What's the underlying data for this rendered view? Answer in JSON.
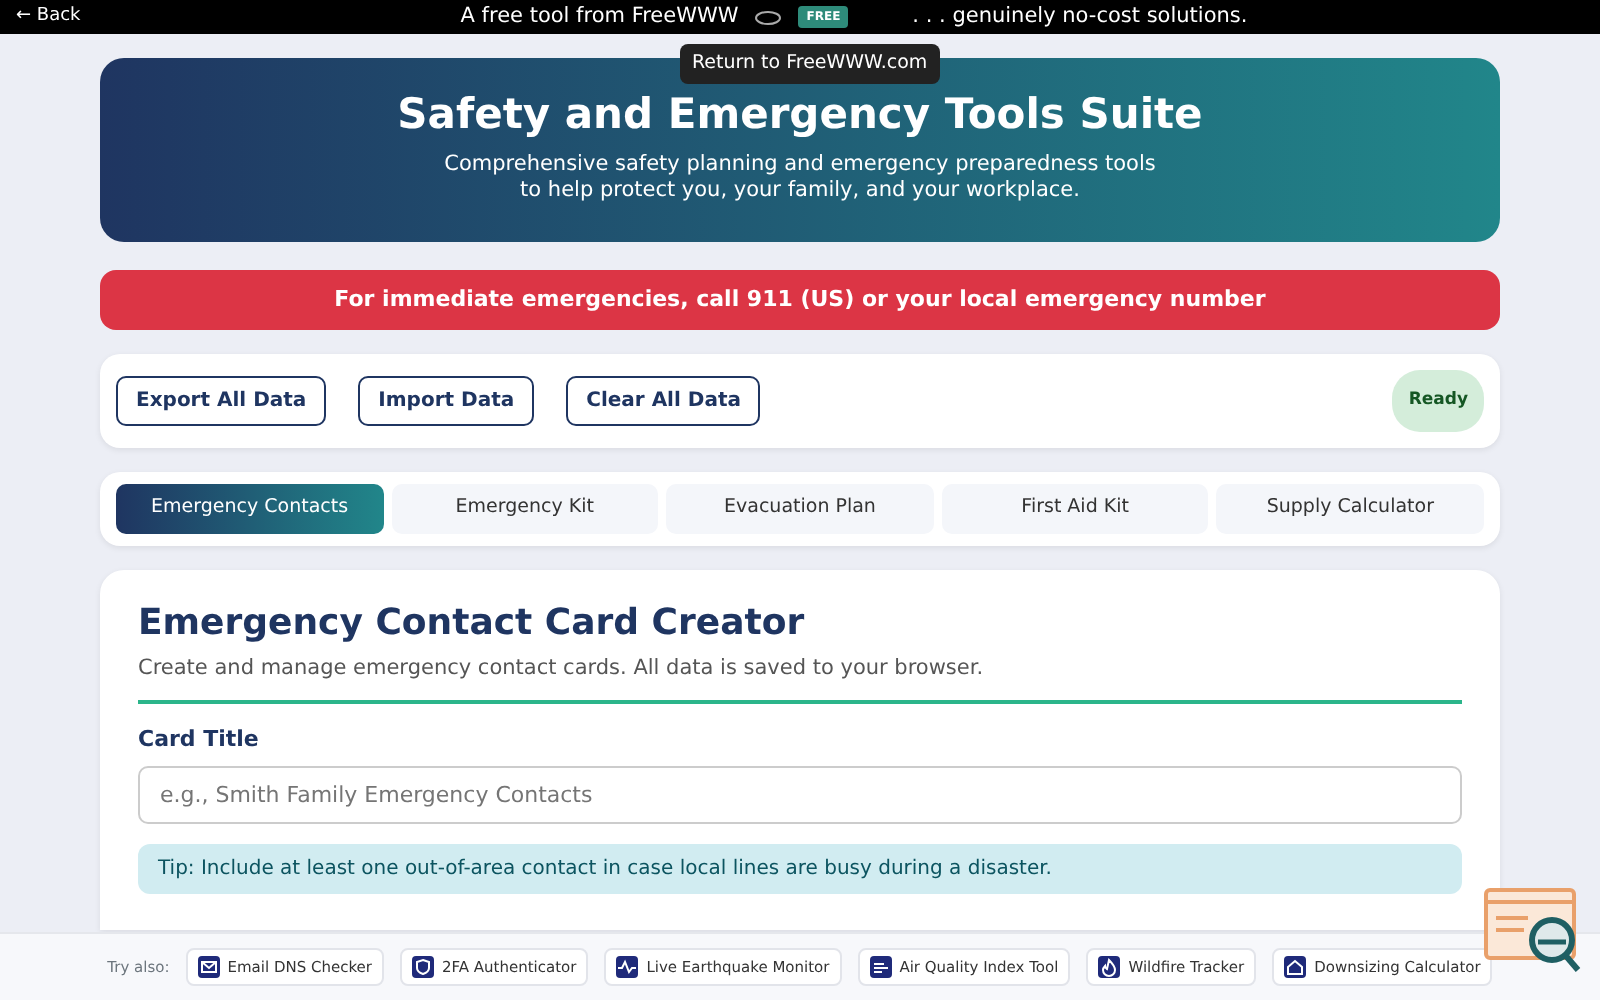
{
  "top_bar": {
    "back": "← Back",
    "promo": "A free tool from FreeWWW",
    "badge": "FREE",
    "tagline": ". . . genuinely no-cost solutions.",
    "tooltip": "Return to FreeWWW.com"
  },
  "header": {
    "title": "Safety and Emergency Tools Suite",
    "subtitle": "Comprehensive safety planning and emergency preparedness tools to help protect you, your family, and your workplace."
  },
  "alert": "For immediate emergencies, call 911 (US) or your local emergency number",
  "actions": [
    "Export All Data",
    "Import Data",
    "Clear All Data"
  ],
  "status": "Ready",
  "tabs": [
    {
      "label": "Emergency Contacts",
      "selected": true
    },
    {
      "label": "Emergency Kit",
      "selected": false
    },
    {
      "label": "Evacuation Plan",
      "selected": false
    },
    {
      "label": "First Aid Kit",
      "selected": false
    },
    {
      "label": "Supply Calculator",
      "selected": false
    }
  ],
  "panel": {
    "title": "Emergency Contact Card Creator",
    "description": "Create and manage emergency contact cards. All data is saved to your browser.",
    "field_label": "Card Title",
    "field_placeholder": "e.g., Smith Family Emergency Contacts",
    "tip": "Tip: Include at least one out-of-area contact in case local lines are busy during a disaster."
  },
  "footer": {
    "label": "Try also:",
    "links": [
      {
        "label": "Email DNS Checker",
        "kind": "mail"
      },
      {
        "label": "2FA Authenticator",
        "kind": "shield"
      },
      {
        "label": "Live Earthquake Monitor",
        "kind": "pulse"
      },
      {
        "label": "Air Quality Index Tool",
        "kind": "wind"
      },
      {
        "label": "Wildfire Tracker",
        "kind": "flame"
      },
      {
        "label": "Downsizing Calculator",
        "kind": "home"
      }
    ]
  }
}
